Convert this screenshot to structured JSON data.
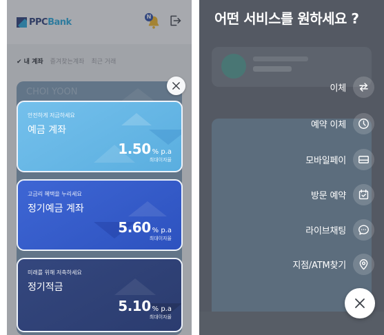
{
  "left": {
    "brand": {
      "name_part1": "PPC",
      "name_part2": "Bank"
    },
    "notification_badge": "N",
    "tabs": [
      "✔ 내 계좌",
      "즐겨찾는계좌",
      "최근 거래"
    ],
    "background_card_name": "CHOI YOON",
    "products": [
      {
        "subtitle": "안전하게 저금하세요",
        "title": "예금 계좌",
        "rate": "1.50",
        "unit": "% p.a",
        "caption": "최대이자율"
      },
      {
        "subtitle": "고금리 혜택을 누리세요",
        "title": "정기예금 계좌",
        "rate": "5.60",
        "unit": "% p.a",
        "caption": "최대이자율"
      },
      {
        "subtitle": "미래를 위해 저축하세요",
        "title": "정기적금",
        "rate": "5.10",
        "unit": "% p.a",
        "caption": "최대이자율"
      }
    ]
  },
  "right": {
    "title": "어떤 서비스를 원하세요 ?",
    "menu": [
      {
        "label": "이체",
        "icon": "transfer-icon"
      },
      {
        "label": "예약 이체",
        "icon": "clock-icon"
      },
      {
        "label": "모바일페이",
        "icon": "card-icon"
      },
      {
        "label": "방문 예약",
        "icon": "calendar-check-icon"
      },
      {
        "label": "라이브채팅",
        "icon": "chat-icon"
      },
      {
        "label": "지점/ATM찾기",
        "icon": "location-pin-icon"
      }
    ]
  },
  "colors": {
    "brand_navy": "#2a3c77",
    "brand_cyan": "#26a6d9",
    "card_light_blue": "#5aaedf",
    "card_blue": "#2d52bf",
    "card_navy": "#2b3c6f"
  }
}
